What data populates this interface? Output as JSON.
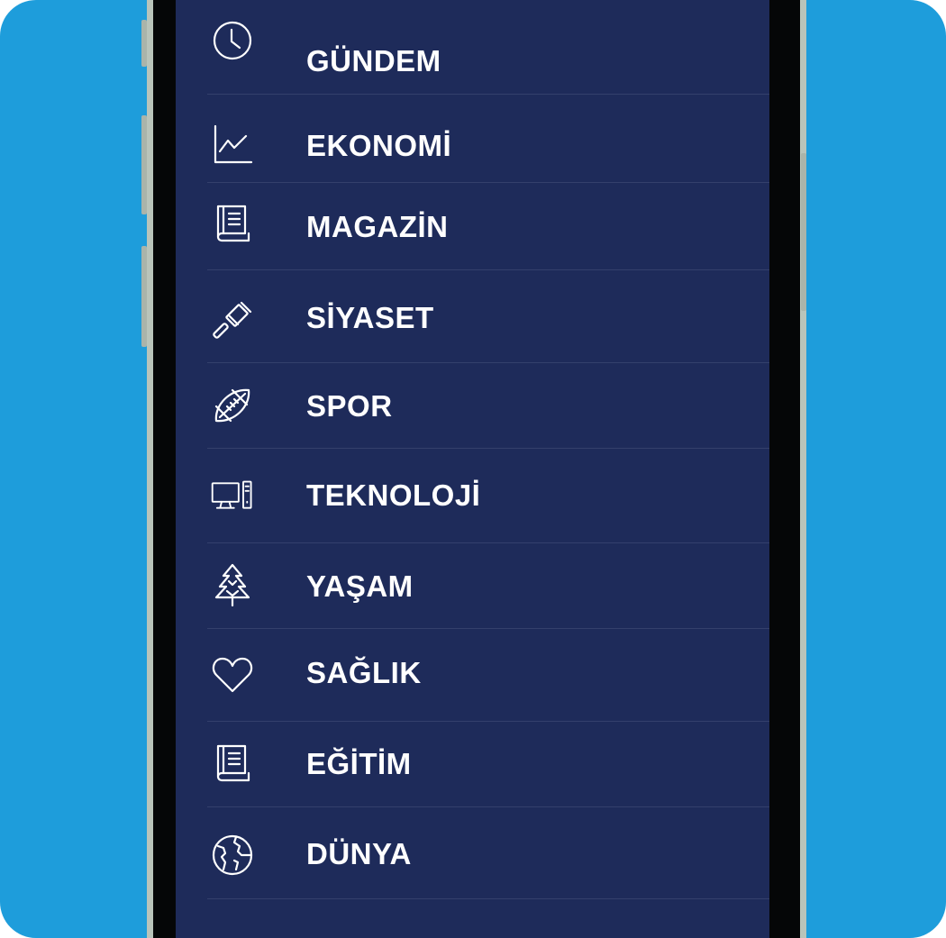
{
  "menu": {
    "items": [
      {
        "label": "GÜNDEM",
        "icon": "clock-icon"
      },
      {
        "label": "EKONOMİ",
        "icon": "line-chart-icon"
      },
      {
        "label": "MAGAZİN",
        "icon": "book-icon"
      },
      {
        "label": "SİYASET",
        "icon": "gavel-icon"
      },
      {
        "label": "SPOR",
        "icon": "football-icon"
      },
      {
        "label": "TEKNOLOJİ",
        "icon": "desktop-computer-icon"
      },
      {
        "label": "YAŞAM",
        "icon": "pine-tree-icon"
      },
      {
        "label": "SAĞLIK",
        "icon": "heart-icon"
      },
      {
        "label": "EĞİTİM",
        "icon": "book-icon"
      },
      {
        "label": "DÜNYA",
        "icon": "globe-icon"
      }
    ]
  },
  "colors": {
    "background": "#1e9ddb",
    "menu_background": "#1e2b5a",
    "divider": "#34406c",
    "text": "#ffffff",
    "phone_frame": "#b9c4ba"
  }
}
